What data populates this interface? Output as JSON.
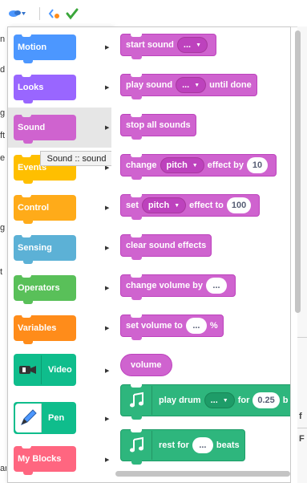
{
  "toolbar": {
    "check_icon": "check-icon",
    "sprite_icon": "sprite-icon",
    "code_icon": "code-icon"
  },
  "background_edge_text": [
    "n",
    "d",
    "g",
    "ft",
    "e",
    "g",
    "t",
    "ar"
  ],
  "right_edge_text": [
    "f",
    "F"
  ],
  "categories": [
    {
      "label": "Motion",
      "color": "#4c97ff",
      "dark": "#3373cc"
    },
    {
      "label": "Looks",
      "color": "#9966ff",
      "dark": "#774dcb"
    },
    {
      "label": "Sound",
      "color": "#cf63cf",
      "dark": "#bd42bd",
      "selected": true
    },
    {
      "label": "Events",
      "color": "#ffbf00",
      "dark": "#cc9900"
    },
    {
      "label": "Control",
      "color": "#ffab19",
      "dark": "#cf8b17"
    },
    {
      "label": "Sensing",
      "color": "#5cb1d6",
      "dark": "#2e8eb8"
    },
    {
      "label": "Operators",
      "color": "#59c059",
      "dark": "#389438"
    },
    {
      "label": "Variables",
      "color": "#ff8c1a",
      "dark": "#db6e00"
    },
    {
      "label": "Video",
      "color": "#0fbd8c",
      "dark": "#0b8e69",
      "icon": "video-sensing-icon"
    },
    {
      "label": "Pen",
      "color": "#0fbd8c",
      "dark": "#0b8e69",
      "icon": "pen-icon"
    },
    {
      "label": "My Blocks",
      "color": "#ff6680",
      "dark": "#ff3355"
    }
  ],
  "tooltip": "Sound :: sound",
  "blocks": {
    "start_sound": {
      "label": "start sound",
      "menu": "..."
    },
    "play_sound": {
      "label": "play sound",
      "menu": "...",
      "suffix": "until done"
    },
    "stop_all": {
      "label": "stop all sounds"
    },
    "change_effect": {
      "label": "change",
      "menu": "pitch",
      "mid": "effect by",
      "value": "10"
    },
    "set_effect": {
      "label": "set",
      "menu": "pitch",
      "mid": "effect to",
      "value": "100"
    },
    "clear_effects": {
      "label": "clear sound effects"
    },
    "change_volume": {
      "label": "change volume by",
      "value": "..."
    },
    "set_volume": {
      "label": "set volume to",
      "value": "...",
      "suffix": "%"
    },
    "volume": {
      "label": "volume"
    },
    "play_drum": {
      "label": "play drum",
      "menu": "...",
      "mid": "for",
      "value": "0.25",
      "suffix": "b"
    },
    "rest_for": {
      "label": "rest for",
      "value": "...",
      "suffix": "beats"
    }
  }
}
